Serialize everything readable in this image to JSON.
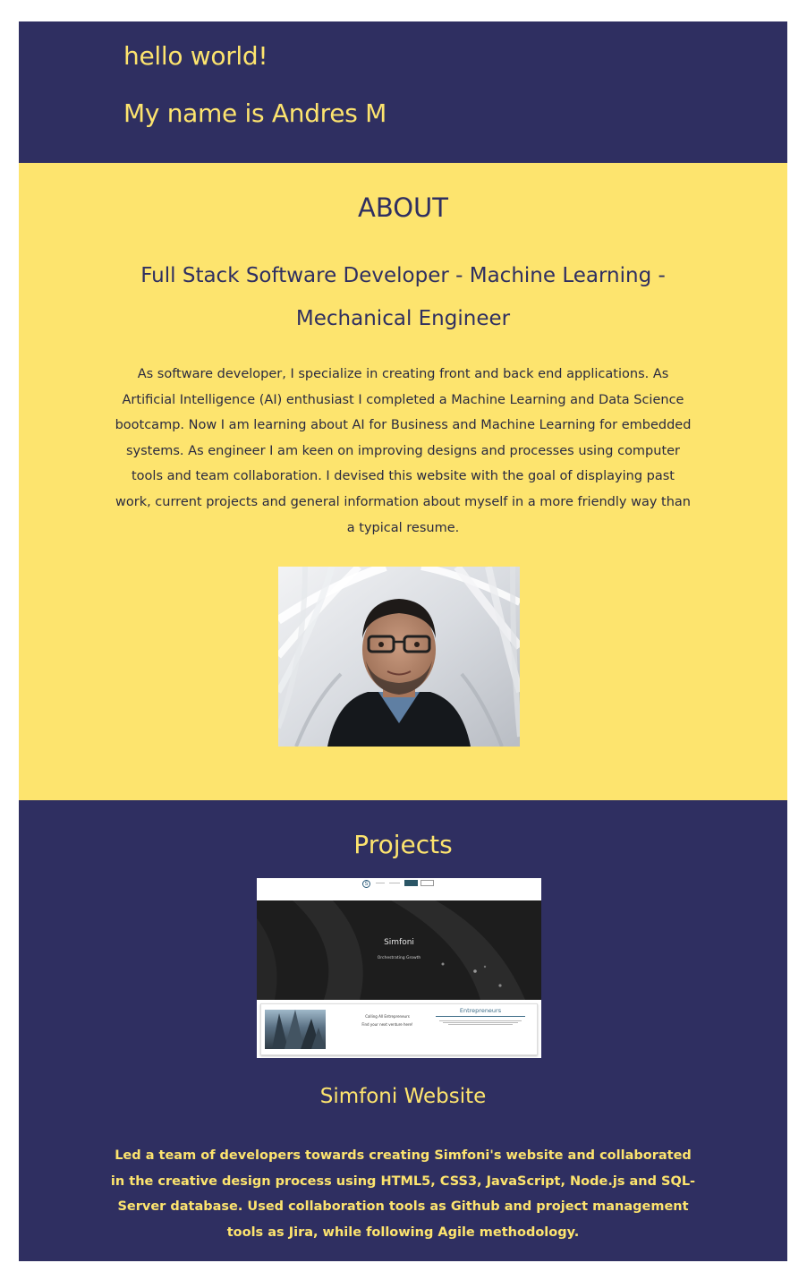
{
  "header": {
    "greeting": "hello world!",
    "name": "My name is Andres M"
  },
  "about": {
    "title": "ABOUT",
    "role": "Full Stack Software Developer - Machine Learning - Mechanical Engineer",
    "bio": "As software developer, I specialize in creating front and back end applications. As Artificial Intelligence (AI) enthusiast I completed a Machine Learning and Data Science bootcamp. Now I am learning about AI for Business and Machine Learning for embedded systems. As engineer I am keen on improving designs and processes using computer tools and team collaboration. I devised this website with the goal of displaying past work, current projects and general information about myself in a more friendly way than a typical resume."
  },
  "projects": {
    "title": "Projects",
    "items": [
      {
        "screenshot": {
          "site_name": "Simfoni",
          "tagline": "Orchestrating Growth",
          "call_line1": "Calling All Entrepreneurs",
          "call_line2": "Find your next venture here!",
          "section_title": "Entrepreneurs"
        },
        "name": "Simfoni Website",
        "description": "Led a team of developers towards creating Simfoni's website and collaborated in the creative design process using HTML5, CSS3, JavaScript, Node.js and SQL-Server database. Used collaboration tools as Github and project management tools as Jira, while following Agile methodology."
      }
    ]
  },
  "colors": {
    "navy": "#2f2f61",
    "yellow": "#fde46e"
  }
}
